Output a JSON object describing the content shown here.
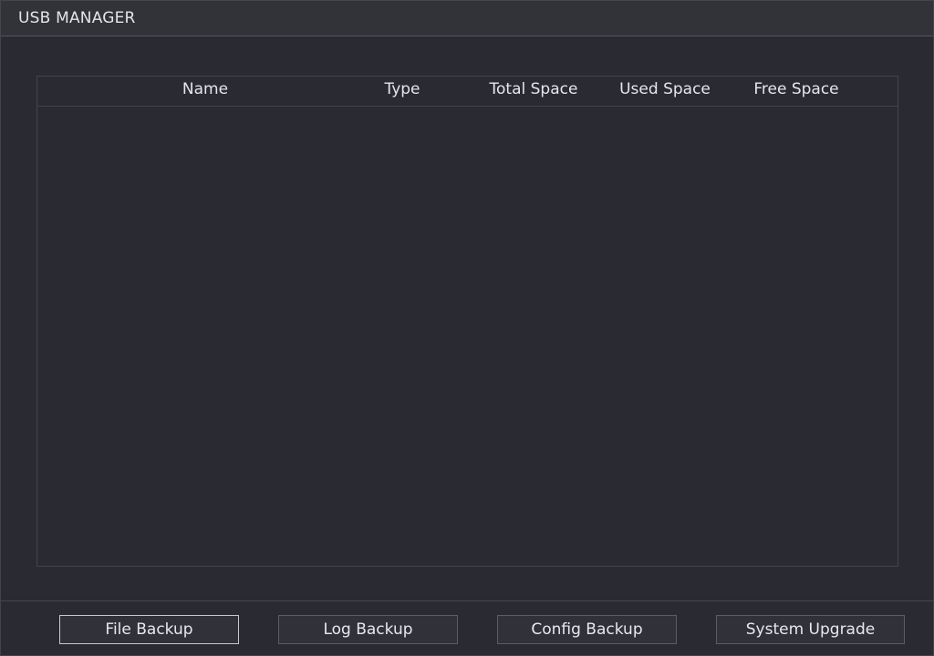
{
  "window": {
    "title": "USB MANAGER"
  },
  "table": {
    "columns": [
      "Name",
      "Type",
      "Total Space",
      "Used Space",
      "Free Space"
    ],
    "rows": []
  },
  "buttons": {
    "file_backup": "File Backup",
    "log_backup": "Log Backup",
    "config_backup": "Config Backup",
    "system_upgrade": "System Upgrade"
  },
  "colors": {
    "background": "#2a2a32",
    "titlebar": "#323239",
    "border": "#44444c",
    "text": "#e6e6ea"
  }
}
